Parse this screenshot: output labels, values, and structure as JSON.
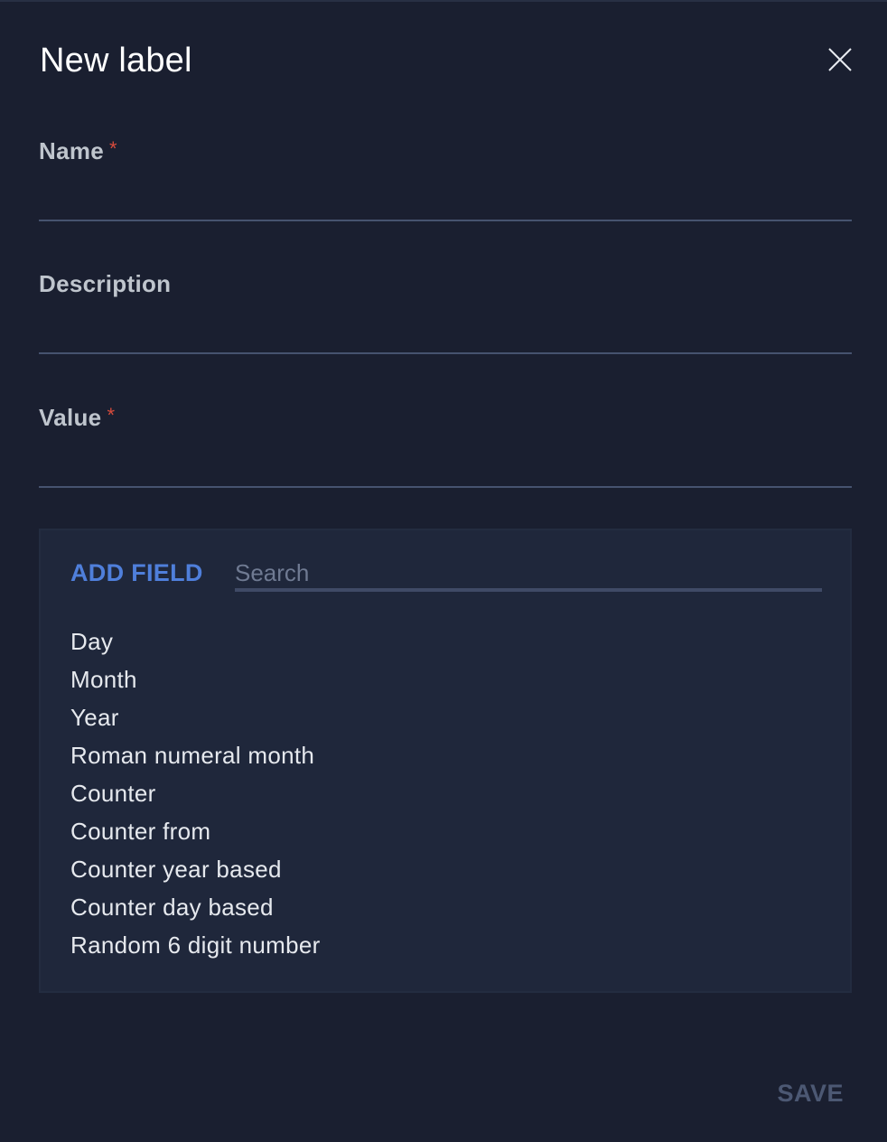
{
  "dialog": {
    "title": "New label",
    "close_icon": "close-icon"
  },
  "fields": {
    "name": {
      "label": "Name",
      "required_mark": "*",
      "value": ""
    },
    "description": {
      "label": "Description",
      "value": ""
    },
    "value": {
      "label": "Value",
      "required_mark": "*",
      "value": ""
    }
  },
  "add_field": {
    "button_label": "ADD FIELD",
    "search_placeholder": "Search",
    "options": [
      "Day",
      "Month",
      "Year",
      "Roman numeral month",
      "Counter",
      "Counter from",
      "Counter year based",
      "Counter day based",
      "Random 6 digit number"
    ]
  },
  "footer": {
    "save_label": "SAVE"
  },
  "colors": {
    "background": "#1a1f30",
    "panel": "#1f273b",
    "accent": "#4f7fdb",
    "required": "#d64b3c",
    "disabled": "#4c5873"
  }
}
